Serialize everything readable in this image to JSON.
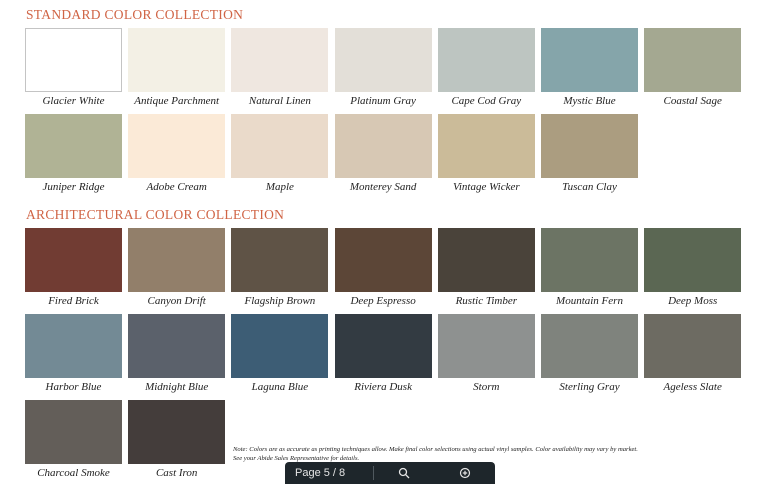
{
  "colors": {
    "heading": "#d06445"
  },
  "standard": {
    "title": "STANDARD COLOR COLLECTION",
    "rows": [
      [
        {
          "name": "Glacier White",
          "color": "#ffffff",
          "bordered": true
        },
        {
          "name": "Antique Parchment",
          "color": "#f3f0e5"
        },
        {
          "name": "Natural Linen",
          "color": "#efe7e0"
        },
        {
          "name": "Platinum Gray",
          "color": "#e3dfd8"
        },
        {
          "name": "Cape Cod Gray",
          "color": "#bdc5c1"
        },
        {
          "name": "Mystic Blue",
          "color": "#85a5aa"
        },
        {
          "name": "Coastal Sage",
          "color": "#a4a891"
        }
      ],
      [
        {
          "name": "Juniper Ridge",
          "color": "#b0b395"
        },
        {
          "name": "Adobe Cream",
          "color": "#fbead7"
        },
        {
          "name": "Maple",
          "color": "#eadaca"
        },
        {
          "name": "Monterey Sand",
          "color": "#d7c8b4"
        },
        {
          "name": "Vintage Wicker",
          "color": "#cbbb99"
        },
        {
          "name": "Tuscan Clay",
          "color": "#ab9d80"
        }
      ]
    ]
  },
  "architectural": {
    "title": "ARCHITECTURAL COLOR COLLECTION",
    "rows": [
      [
        {
          "name": "Fired Brick",
          "color": "#713c33"
        },
        {
          "name": "Canyon Drift",
          "color": "#927f6a"
        },
        {
          "name": "Flagship Brown",
          "color": "#5f5346"
        },
        {
          "name": "Deep Espresso",
          "color": "#5c4637"
        },
        {
          "name": "Rustic Timber",
          "color": "#4a433a"
        },
        {
          "name": "Mountain Fern",
          "color": "#6c7464"
        },
        {
          "name": "Deep Moss",
          "color": "#5b6753"
        }
      ],
      [
        {
          "name": "Harbor Blue",
          "color": "#738a95"
        },
        {
          "name": "Midnight Blue",
          "color": "#5b616b"
        },
        {
          "name": "Laguna Blue",
          "color": "#3d5d75"
        },
        {
          "name": "Riviera Dusk",
          "color": "#333b42"
        },
        {
          "name": "Storm",
          "color": "#8e9190"
        },
        {
          "name": "Sterling Gray",
          "color": "#7f837d"
        },
        {
          "name": "Ageless Slate",
          "color": "#6d6b62"
        }
      ],
      [
        {
          "name": "Charcoal Smoke",
          "color": "#635e59"
        },
        {
          "name": "Cast Iron",
          "color": "#443d3b"
        }
      ]
    ]
  },
  "note": {
    "line1": "Note: Colors are as accurate as printing techniques allow. Make final color selections using actual vinyl samples. Color availability may vary by market.",
    "line2": "See your Abide Sales Representative for details."
  },
  "viewer_toolbar": {
    "page_indicator": "Page 5 / 8",
    "search_icon": "magnifier-icon",
    "zoom_icon": "zoom-icon"
  }
}
